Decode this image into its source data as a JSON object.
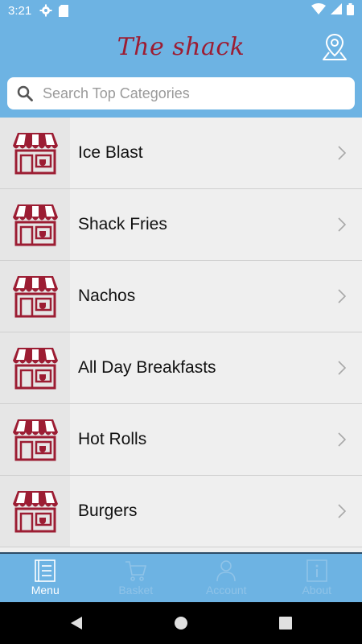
{
  "status_bar": {
    "time": "3:21",
    "icons": [
      "gear-icon",
      "sd-card-icon",
      "wifi-icon",
      "signal-icon",
      "battery-icon"
    ]
  },
  "app_bar": {
    "title": "The shack",
    "location_icon": "location-pin-icon"
  },
  "search": {
    "placeholder": "Search Top Categories",
    "value": ""
  },
  "categories": [
    {
      "label": "Ice Blast",
      "icon": "shop-awning-icon"
    },
    {
      "label": "Shack Fries",
      "icon": "shop-awning-icon"
    },
    {
      "label": "Nachos",
      "icon": "shop-awning-icon"
    },
    {
      "label": "All Day Breakfasts",
      "icon": "shop-awning-icon"
    },
    {
      "label": "Hot Rolls",
      "icon": "shop-awning-icon"
    },
    {
      "label": "Burgers",
      "icon": "shop-awning-icon"
    }
  ],
  "bottom_nav": [
    {
      "label": "Menu",
      "icon": "menu-list-icon",
      "active": true
    },
    {
      "label": "Basket",
      "icon": "cart-icon",
      "active": false
    },
    {
      "label": "Account",
      "icon": "person-icon",
      "active": false
    },
    {
      "label": "About",
      "icon": "info-icon",
      "active": false
    }
  ],
  "colors": {
    "primary": "#6db3e3",
    "brand": "#9c1d33",
    "list_background": "#efefef"
  }
}
